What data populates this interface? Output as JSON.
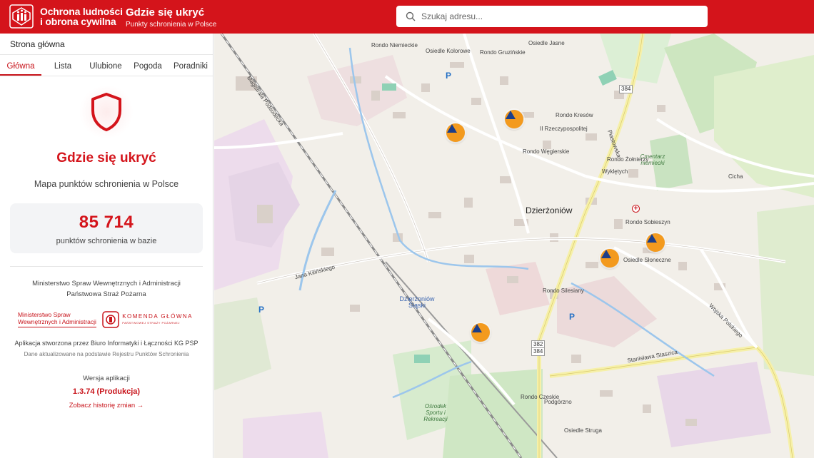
{
  "header": {
    "brand_line1": "Ochrona ludności",
    "brand_line2": "i obrona cywilna",
    "title": "Gdzie się ukryć",
    "subtitle": "Punkty schronienia w Polsce",
    "search_placeholder": "Szukaj adresu...",
    "bg_color": "#d4141b"
  },
  "sidebar": {
    "breadcrumb": "Strona główna",
    "tabs": [
      "Główna",
      "Lista",
      "Ulubione",
      "Pogoda",
      "Poradniki"
    ],
    "active_tab": "Główna",
    "hero_icon": "shield-icon",
    "hero_title": "Gdzie się ukryć",
    "hero_subtitle": "Mapa punktów schronienia w Polsce",
    "stat_value": "85 714",
    "stat_label": "punktów schronienia w bazie",
    "org_line1": "Ministerstwo Spraw Wewnętrznych i Administracji",
    "org_line2": "Państwowa Straż Pożarna",
    "mswia_logo_line1": "Ministerstwo Spraw",
    "mswia_logo_line2": "Wewnętrznych i Administracji",
    "kg_logo_text": "KOMENDA GŁÓWNA",
    "kg_logo_sub": "PAŃSTWOWEJ STRAŻY POŻARNEJ",
    "credit": "Aplikacja stworzona przez Biuro Informatyki i Łączności KG PSP",
    "data_note": "Dane aktualizowane na podstawie Rejestru Punktów Schronienia",
    "version_label": "Wersja aplikacji",
    "version": "1.3.74 (Produkcja)",
    "history_link": "Zobacz historię zmian →"
  },
  "map": {
    "city": "Dzierżoniów",
    "marker_icon": "shelter-triangle-icon",
    "marker_color": "#f39a1e",
    "labels": {
      "osiedle_kolorowe": "Osiedle Kolorowe",
      "rondo_niemieckie": "Rondo Niemieckie",
      "rondo_gruzinskie": "Rondo Gruzińskie",
      "osiedle_jasne": "Osiedle Jasne",
      "rondo_kresow": "Rondo Kresów",
      "rzeczpospolitej": "II Rzeczypospolitej",
      "rondo_wegierskie": "Rondo Węgierskie",
      "rondo_zolnierzy": "Rondo Żołnierzy",
      "wykletych": "Wyklętych",
      "cmentarz": "Cmentarz niemiecki",
      "cicha": "Cicha",
      "rondo_sobieszyn": "Rondo Sobieszyn",
      "osiedle_sloneczne": "Osiedle Słoneczne",
      "rondo_silesiany": "Rondo Silesiany",
      "station": "Dzierżoniów Śląski",
      "rondo_czeskie": "Rondo Czeskie",
      "podgorzno": "Podgórzno",
      "osiedle_struga": "Osiedle Struga",
      "osrodek": "Ośrodek Sportu i Rekreacji",
      "stanislawa": "Stanisława Staszica",
      "jana_kilinskiego": "Jana Kilińskiego",
      "wojska_polskiego": "Wojska Polskiego",
      "magistrala": "Magistrala Podsudecka",
      "piastowska": "Piastowska",
      "road_384": "384",
      "road_382": "382"
    }
  }
}
